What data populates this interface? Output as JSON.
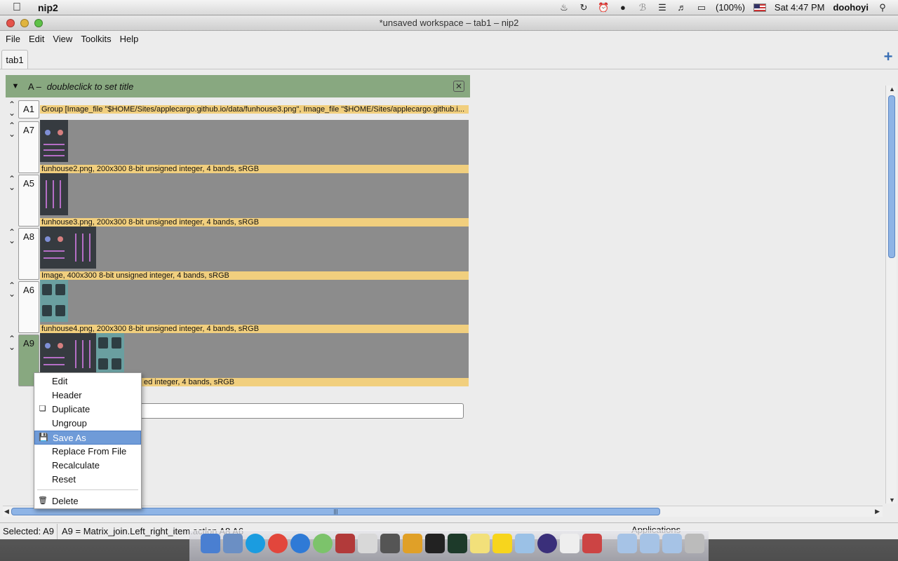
{
  "menubar": {
    "app_name": "nip2",
    "battery": "(100%)",
    "clock": "Sat 4:47 PM",
    "user": "doohoyi"
  },
  "window": {
    "title": "*unsaved workspace – tab1 – nip2",
    "menus": [
      "File",
      "Edit",
      "View",
      "Toolkits",
      "Help"
    ]
  },
  "tabs": {
    "active": "tab1"
  },
  "column": {
    "name": "A –",
    "title": "doubleclick to set title"
  },
  "rows": {
    "A1": {
      "label": "A1",
      "caption": "Group [Image_file \"$HOME/Sites/applecargo.github.io/data/funhouse3.png\", Image_file \"$HOME/Sites/applecargo.github.i..."
    },
    "A7": {
      "label": "A7",
      "caption": "funhouse2.png, 200x300 8-bit unsigned integer, 4 bands, sRGB"
    },
    "A5": {
      "label": "A5",
      "caption": "funhouse3.png, 200x300 8-bit unsigned integer, 4 bands, sRGB"
    },
    "A8": {
      "label": "A8",
      "caption": "Image, 400x300 8-bit unsigned integer, 4 bands, sRGB"
    },
    "A6": {
      "label": "A6",
      "caption": "funhouse4.png, 200x300 8-bit unsigned integer, 4 bands, sRGB"
    },
    "A9": {
      "label": "A9",
      "caption": "ed integer, 4 bands, sRGB"
    }
  },
  "context_menu": {
    "items": [
      "Edit",
      "Header",
      "Duplicate",
      "Ungroup",
      "Save As",
      "Replace From File",
      "Recalculate",
      "Reset",
      "Delete"
    ],
    "highlighted": "Save As"
  },
  "statusbar": {
    "selected": "Selected: A9",
    "expression": "A9 = Matrix_join.Left_right_item.action A8 A6"
  },
  "dock": {
    "applications_label": "Applications"
  },
  "colors": {
    "column_header": "#88a880",
    "caption": "#f1cf7e",
    "highlight": "#6f9bd8"
  }
}
